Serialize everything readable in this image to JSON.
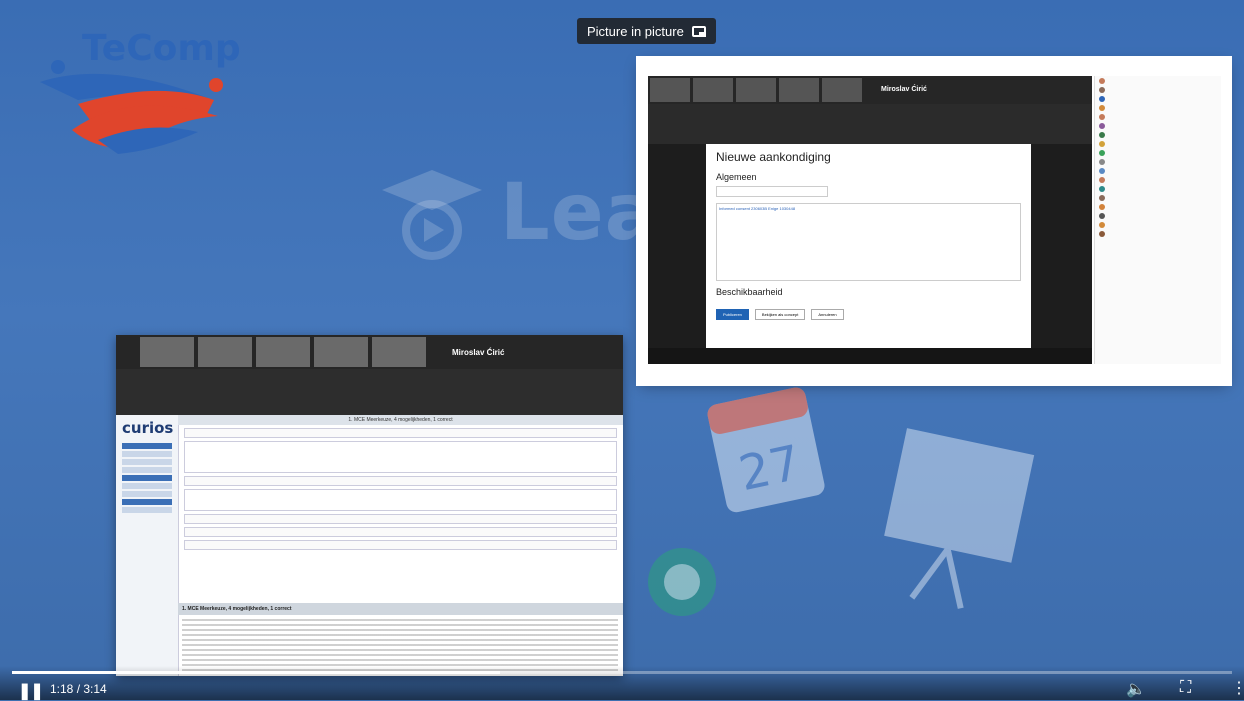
{
  "logo": {
    "text": "TeComp"
  },
  "watermark": {
    "text": "Lear"
  },
  "pip_button": {
    "label": "Picture in picture",
    "icon": "picture-in-picture-icon"
  },
  "top_share": {
    "presenter_name": "Miroslav Ćirić",
    "doc_title": "Nieuwe aankondiging",
    "section_general": "Algemeen",
    "section_availability": "Beschikbaarheid",
    "editor_link": "Informed consent 230603B Enige 1030448",
    "buttons": [
      "Publiceren",
      "Bekijken als concept",
      "Annuleren"
    ]
  },
  "lower_share": {
    "presenter_name": "Miroslav Ćirić",
    "app_logo": "curios",
    "question_title": "1. MCE Meerkeuze, 4 mogelijkheden, 1 correct",
    "footer_title": "1. MCE Meerkeuze, 4 mogelijkheden, 1 correct"
  },
  "player": {
    "time": "1:18 / 3:14",
    "progress": 0.4,
    "play_state": "pause-icon",
    "volume_icon": "volume-icon",
    "fullscreen_icon": "fullscreen-icon",
    "more_icon": "more-icon"
  },
  "colors": {
    "background": "#3e6fb0",
    "accent_blue": "#1f63b4",
    "logo_red": "#e0452c"
  }
}
